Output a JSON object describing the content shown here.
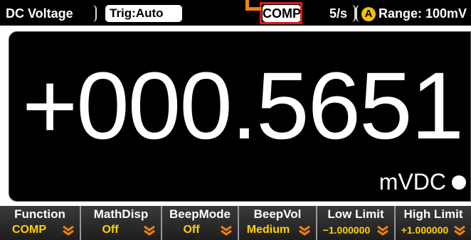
{
  "statusbar": {
    "function": "DC Voltage",
    "trigger": "Trig:Auto",
    "comp": "COMP",
    "rate": "5/s",
    "range_badge": "A",
    "range": "Range: 100mV"
  },
  "display": {
    "reading": "+000.5651",
    "unit": "mVDC"
  },
  "softkeys": [
    {
      "label": "Function",
      "value": "COMP",
      "icon": "chevron-down-icon"
    },
    {
      "label": "MathDisp",
      "value": "Off",
      "icon": "chevron-down-icon"
    },
    {
      "label": "BeepMode",
      "value": "Off",
      "icon": "chevron-down-icon"
    },
    {
      "label": "BeepVol",
      "value": "Medium",
      "icon": "chevron-down-icon"
    },
    {
      "label": "Low Limit",
      "value": "−1.000000",
      "icon": "chevron-down-icon"
    },
    {
      "label": "High Limit",
      "value": "+1.000000",
      "icon": "chevron-down-icon"
    }
  ],
  "colors": {
    "background": "#000000",
    "text": "#ffffff",
    "softkey_value": "#ffd200",
    "arrow": "#f08010",
    "highlight": "#e01818",
    "range_badge": "#f2c300"
  }
}
